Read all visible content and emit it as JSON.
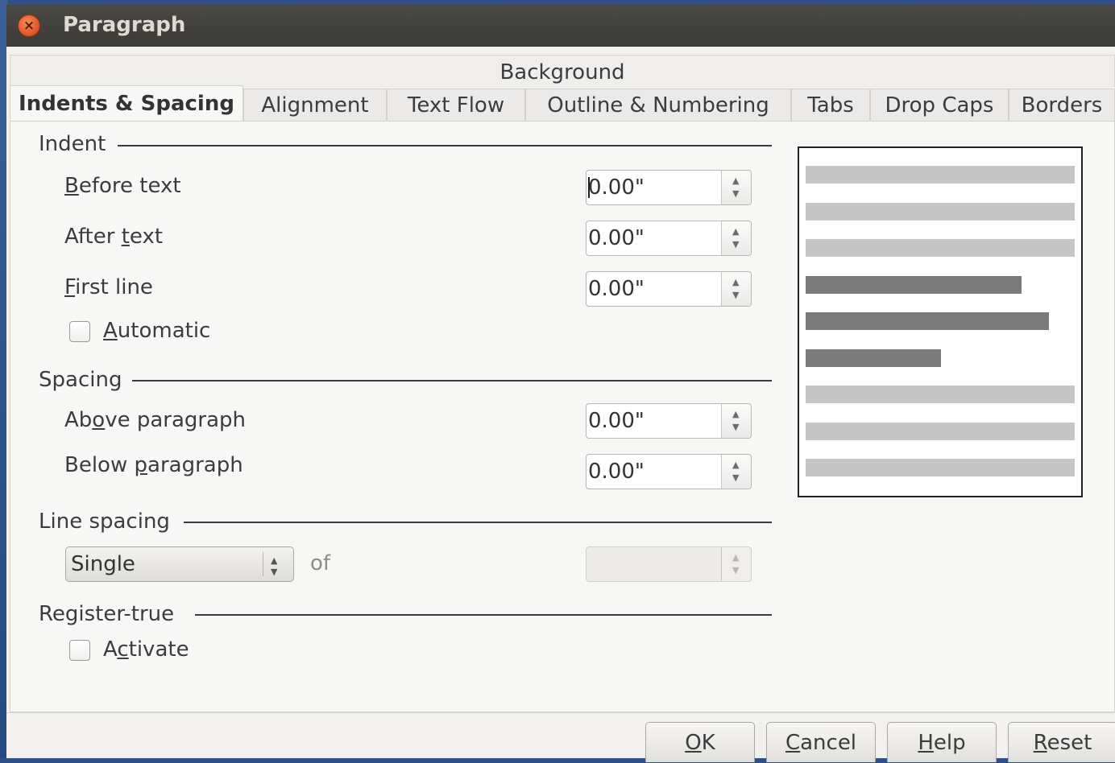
{
  "window": {
    "title": "Paragraph"
  },
  "tabs": {
    "top_row": [
      "Background"
    ],
    "bottom_row": [
      "Indents & Spacing",
      "Alignment",
      "Text Flow",
      "Outline & Numbering",
      "Tabs",
      "Drop Caps",
      "Borders"
    ],
    "active": "Indents & Spacing"
  },
  "indent": {
    "heading": "Indent",
    "before_text": {
      "pre": "",
      "mnemonic": "B",
      "post": "efore text",
      "value": "0.00\""
    },
    "after_text": {
      "pre": "After ",
      "mnemonic": "t",
      "post": "ext",
      "value": "0.00\""
    },
    "first_line": {
      "pre": "",
      "mnemonic": "F",
      "post": "irst line",
      "value": "0.00\""
    },
    "automatic": {
      "pre": "",
      "mnemonic": "A",
      "post": "utomatic",
      "checked": false
    }
  },
  "spacing": {
    "heading": "Spacing",
    "above": {
      "pre": "Ab",
      "mnemonic": "o",
      "post": "ve paragraph",
      "value": "0.00\""
    },
    "below": {
      "pre": "Below ",
      "mnemonic": "p",
      "post": "aragraph",
      "value": "0.00\""
    }
  },
  "line_spacing": {
    "heading": "Line spacing",
    "selected": "Single",
    "of_label": "of",
    "of_value": ""
  },
  "register_true": {
    "heading": "Register-true",
    "activate": {
      "pre": "A",
      "mnemonic": "c",
      "post": "tivate",
      "checked": false
    }
  },
  "colors": {
    "preview_light": "#c6c6c6",
    "preview_dark": "#7a7a7a",
    "close_button": "#e35a2a"
  },
  "buttons": {
    "ok": {
      "pre": "",
      "mnemonic": "O",
      "post": "K"
    },
    "cancel": {
      "pre": "",
      "mnemonic": "C",
      "post": "ancel"
    },
    "help": {
      "pre": "",
      "mnemonic": "H",
      "post": "elp"
    },
    "reset": {
      "pre": "",
      "mnemonic": "R",
      "post": "eset"
    }
  }
}
